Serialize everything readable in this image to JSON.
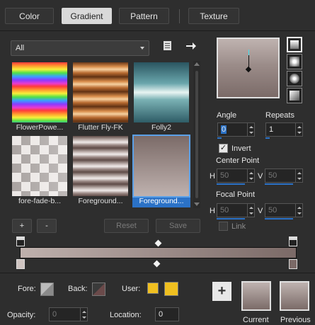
{
  "tabs": [
    {
      "label": "Color",
      "active": false
    },
    {
      "label": "Gradient",
      "active": true
    },
    {
      "label": "Pattern",
      "active": false
    },
    {
      "label": "Texture",
      "active": false
    }
  ],
  "category_select": {
    "value": "All"
  },
  "gradients": [
    {
      "label": "FlowerPowe...",
      "selected": false
    },
    {
      "label": "Flutter Fly-FK",
      "selected": false
    },
    {
      "label": "Folly2",
      "selected": false
    },
    {
      "label": "fore-fade-b...",
      "selected": false
    },
    {
      "label": "Foreground...",
      "selected": false
    },
    {
      "label": "Foreground...",
      "selected": true
    }
  ],
  "buttons": {
    "add": "+",
    "remove": "-",
    "reset": "Reset",
    "save": "Save",
    "add_to_palette": "+"
  },
  "settings": {
    "angle_label": "Angle",
    "angle_value": "0",
    "repeats_label": "Repeats",
    "repeats_value": "1",
    "invert_label": "Invert",
    "invert_checked": true,
    "center_point_label": "Center Point",
    "center_h_label": "H",
    "center_h_value": "50",
    "center_v_label": "V",
    "center_v_value": "50",
    "focal_point_label": "Focal Point",
    "focal_h_label": "H",
    "focal_h_value": "50",
    "focal_v_label": "V",
    "focal_v_value": "50",
    "link_label": "Link",
    "link_checked": false
  },
  "style_buttons": [
    "linear-style-icon",
    "rectangular-style-icon",
    "sunburst-style-icon",
    "radial-style-icon"
  ],
  "bottom": {
    "fore_label": "Fore:",
    "back_label": "Back:",
    "user_label": "User:",
    "opacity_label": "Opacity:",
    "opacity_value": "0",
    "location_label": "Location:",
    "location_value": "0",
    "current_label": "Current",
    "previous_label": "Previous"
  },
  "colors": {
    "accent": "#2b72c7",
    "user_swatch": "#f0c020",
    "gradient_start": "#bfb1ad",
    "gradient_end": "#7b6a67"
  }
}
